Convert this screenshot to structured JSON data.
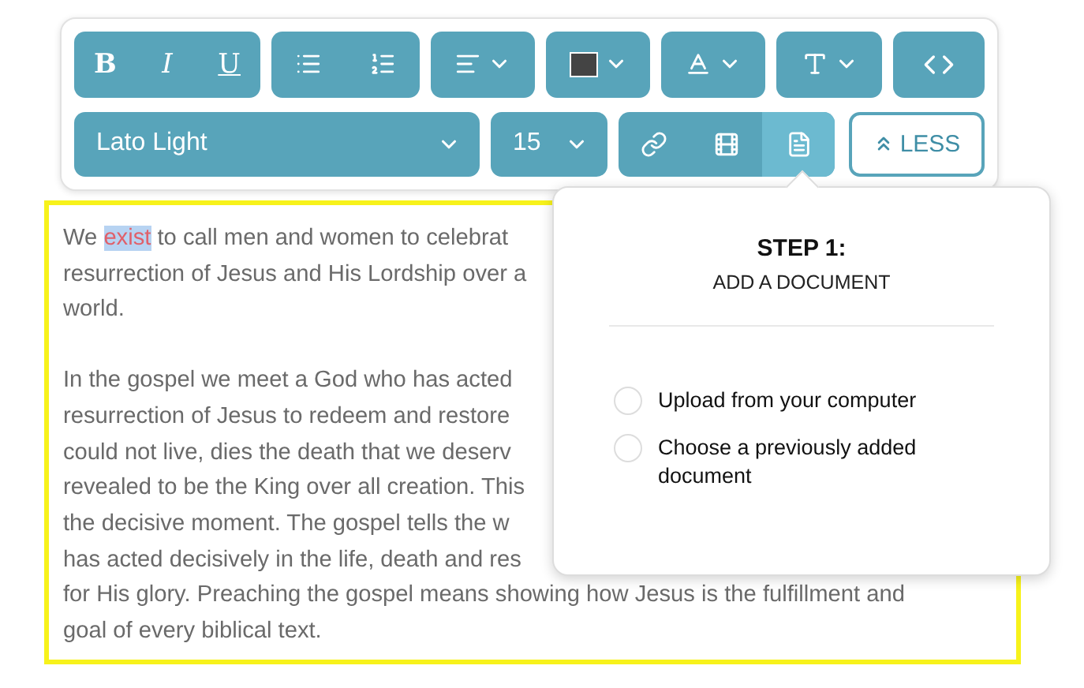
{
  "toolbar": {
    "format_buttons": [
      {
        "kind": "bold",
        "label": "B"
      },
      {
        "kind": "italic",
        "label": "I"
      },
      {
        "kind": "underline",
        "label": "U"
      }
    ],
    "list_buttons": [
      {
        "kind": "bullets"
      },
      {
        "kind": "numbered"
      }
    ],
    "menus": [
      {
        "kind": "align"
      },
      {
        "kind": "color"
      },
      {
        "kind": "textsize"
      },
      {
        "kind": "spacing"
      },
      {
        "kind": "code"
      }
    ],
    "font_select": {
      "value": "Lato Light"
    },
    "size_select": {
      "value": "15"
    },
    "insert_group": [
      {
        "kind": "link",
        "selected": false
      },
      {
        "kind": "video",
        "selected": false
      },
      {
        "kind": "document",
        "selected": true
      }
    ],
    "less_button": "LESS"
  },
  "editor": {
    "paragraphs": [
      {
        "lines": [
          [
            {
              "text": "We "
            },
            {
              "text": "exist",
              "selected": true
            },
            {
              "text": " to call men and women to celebrat"
            }
          ],
          [
            {
              "text": "resurrection of Jesus and His Lordship over a"
            }
          ],
          [
            {
              "text": "world."
            }
          ]
        ]
      },
      {
        "lines": [
          [
            {
              "text": "In the gospel we meet a God who has acted"
            }
          ],
          [
            {
              "text": "resurrection of Jesus to redeem and restore"
            }
          ],
          [
            {
              "text": "could not live, dies the death that we deserv"
            }
          ],
          [
            {
              "text": "revealed to be the King over all creation. This"
            }
          ],
          [
            {
              "text": "the decisive moment. The gospel tells the w"
            }
          ],
          [
            {
              "text": "has acted decisively in the life, death and res"
            }
          ],
          [
            {
              "text": "for His glory. Preaching the gospel means showing how Jesus is the fulfillment and"
            }
          ],
          [
            {
              "text": "goal of every biblical text."
            }
          ]
        ]
      }
    ]
  },
  "popup": {
    "title": "STEP 1:",
    "subtitle": "ADD A DOCUMENT",
    "options": [
      {
        "label": "Upload from your computer",
        "selected": false
      },
      {
        "label": "Choose a previously added document",
        "selected": false
      }
    ]
  }
}
